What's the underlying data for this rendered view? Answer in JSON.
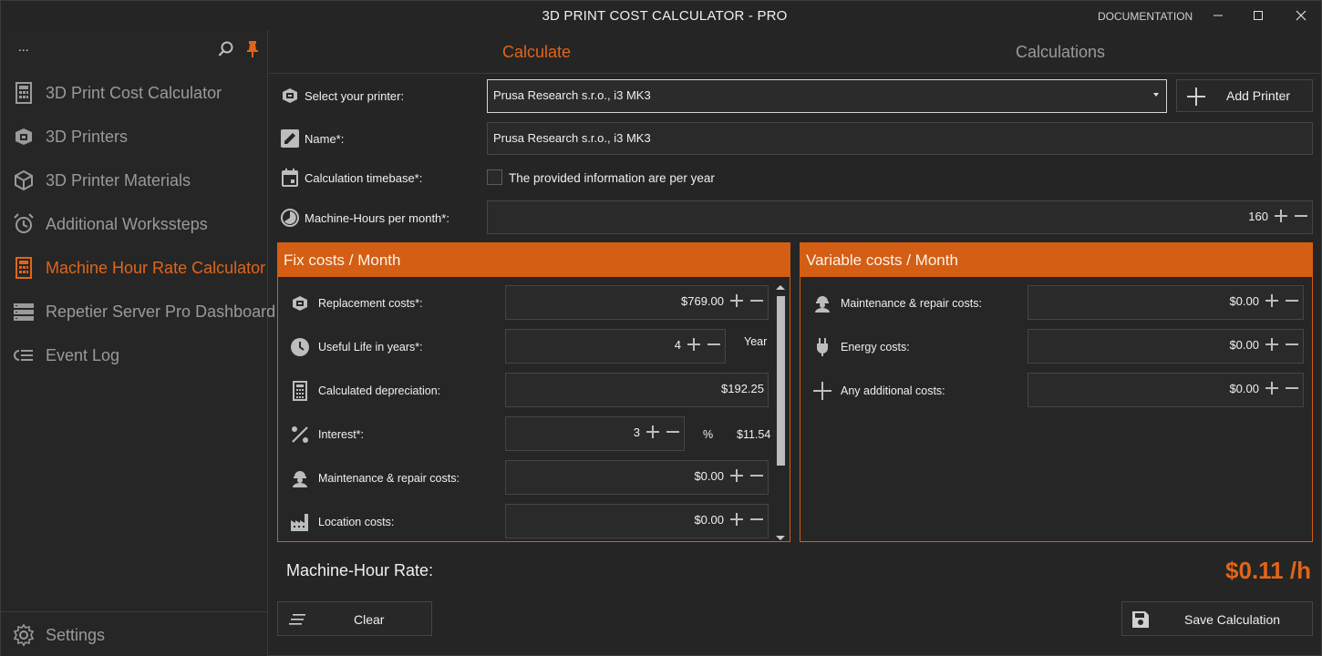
{
  "window": {
    "title": "3D PRINT COST CALCULATOR - PRO",
    "documentation": "DOCUMENTATION"
  },
  "sidebar": {
    "top_text": "...",
    "items": [
      {
        "label": "3D Print Cost Calculator",
        "icon": "calculator-icon",
        "active": false
      },
      {
        "label": "3D Printers",
        "icon": "printer-icon",
        "active": false
      },
      {
        "label": "3D Printer Materials",
        "icon": "cube-icon",
        "active": false
      },
      {
        "label": "Additional Workssteps",
        "icon": "alarm-clock-icon",
        "active": false
      },
      {
        "label": "Machine Hour Rate Calculator",
        "icon": "calculator-icon",
        "active": true
      },
      {
        "label": "Repetier Server Pro Dashboard",
        "icon": "server-icon",
        "active": false
      },
      {
        "label": "Event Log",
        "icon": "log-icon",
        "active": false
      }
    ],
    "settings_label": "Settings"
  },
  "tabs": {
    "calculate": "Calculate",
    "calculations": "Calculations"
  },
  "form": {
    "printer_label": "Select your printer:",
    "printer_value": "Prusa Research s.r.o., i3 MK3",
    "add_printer": "Add Printer",
    "name_label": "Name*:",
    "name_value": "Prusa Research s.r.o., i3 MK3",
    "timebase_label": "Calculation timebase*:",
    "timebase_checkbox": "The provided information are per year",
    "timebase_checked": false,
    "hours_label": "Machine-Hours per month*:",
    "hours_value": "160"
  },
  "fix_costs": {
    "title": "Fix costs / Month",
    "replacement_label": "Replacement costs*:",
    "replacement_value": "$769.00",
    "useful_life_label": "Useful Life in years*:",
    "useful_life_value": "4",
    "useful_life_unit": "Year",
    "depreciation_label": "Calculated depreciation:",
    "depreciation_value": "$192.25",
    "interest_label": "Interest*:",
    "interest_value": "3",
    "interest_unit": "%",
    "interest_amount": "$11.54",
    "maintenance_label": "Maintenance & repair costs:",
    "maintenance_value": "$0.00",
    "location_label": "Location costs:",
    "location_value": "$0.00"
  },
  "variable_costs": {
    "title": "Variable costs / Month",
    "maintenance_label": "Maintenance & repair costs:",
    "maintenance_value": "$0.00",
    "energy_label": "Energy costs:",
    "energy_value": "$0.00",
    "additional_label": "Any additional costs:",
    "additional_value": "$0.00"
  },
  "result": {
    "label": "Machine-Hour Rate:",
    "value": "$0.11 /h"
  },
  "actions": {
    "clear": "Clear",
    "save": "Save Calculation"
  },
  "colors": {
    "accent": "#d45e14",
    "accent_text": "#e0651a",
    "background": "#252525"
  }
}
